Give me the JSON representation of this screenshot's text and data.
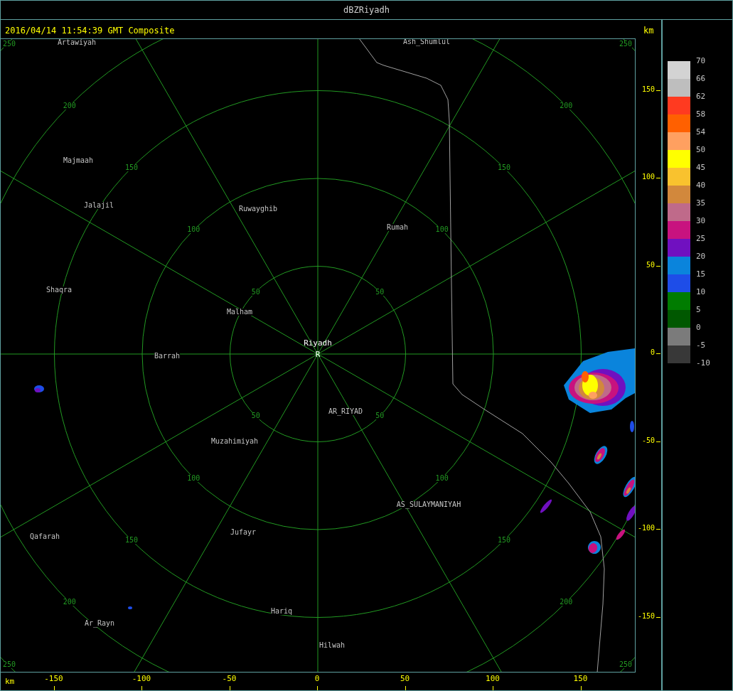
{
  "window": {
    "title": "dBZRiyadh"
  },
  "header": {
    "timestamp": "2016/04/14 11:54:39 GMT Composite",
    "unit": "km"
  },
  "radar_site": {
    "name": "Riyadh",
    "marker": "R"
  },
  "places": [
    {
      "label": "Artawiyah"
    },
    {
      "label": "Ash_Shumlul"
    },
    {
      "label": "Majmaah"
    },
    {
      "label": "Jalajil"
    },
    {
      "label": "Ruwayghib"
    },
    {
      "label": "Rumah"
    },
    {
      "label": "Shaqra"
    },
    {
      "label": "Malham"
    },
    {
      "label": "Barrah"
    },
    {
      "label": "AR_RIYAD"
    },
    {
      "label": "Muzahimiyah"
    },
    {
      "label": "AS_SULAYMANIYAH"
    },
    {
      "label": "Qafarah"
    },
    {
      "label": "Jufayr"
    },
    {
      "label": "Hariq"
    },
    {
      "label": "Ar_Rayn"
    },
    {
      "label": "Hilwah"
    }
  ],
  "range_rings": [
    {
      "labels": [
        "50",
        "50",
        "50",
        "50"
      ]
    },
    {
      "labels": [
        "100",
        "100",
        "100",
        "100"
      ]
    },
    {
      "labels": [
        "150",
        "150",
        "150",
        "150"
      ]
    },
    {
      "labels": [
        "200",
        "200",
        "200",
        "200"
      ]
    },
    {
      "labels": [
        "250",
        "250",
        "250",
        "250"
      ]
    }
  ],
  "y_axis": {
    "ticks": [
      "150",
      "100",
      "50",
      "0",
      "-50",
      "-100",
      "-150"
    ]
  },
  "x_axis": {
    "unit": "km",
    "ticks": [
      "-150",
      "-100",
      "-50",
      "0",
      "50",
      "100",
      "150"
    ]
  },
  "legend": {
    "items": [
      {
        "label": "70",
        "color": "#d3d3d3"
      },
      {
        "label": "66",
        "color": "#bebebe"
      },
      {
        "label": "62",
        "color": "#ff3a20"
      },
      {
        "label": "58",
        "color": "#ff6000"
      },
      {
        "label": "54",
        "color": "#ffa060"
      },
      {
        "label": "50",
        "color": "#ffff00"
      },
      {
        "label": "45",
        "color": "#f9c22e"
      },
      {
        "label": "40",
        "color": "#d2883c"
      },
      {
        "label": "35",
        "color": "#bf6a8a"
      },
      {
        "label": "30",
        "color": "#c8127f"
      },
      {
        "label": "25",
        "color": "#7010c0"
      },
      {
        "label": "20",
        "color": "#0a84dc"
      },
      {
        "label": "15",
        "color": "#1e4de8"
      },
      {
        "label": "10",
        "color": "#007c00"
      },
      {
        "label": "5",
        "color": "#005800"
      },
      {
        "label": "0",
        "color": "#7b7b7b"
      },
      {
        "label": "-5",
        "color": "#383838"
      }
    ],
    "bottom_label": "-10"
  }
}
